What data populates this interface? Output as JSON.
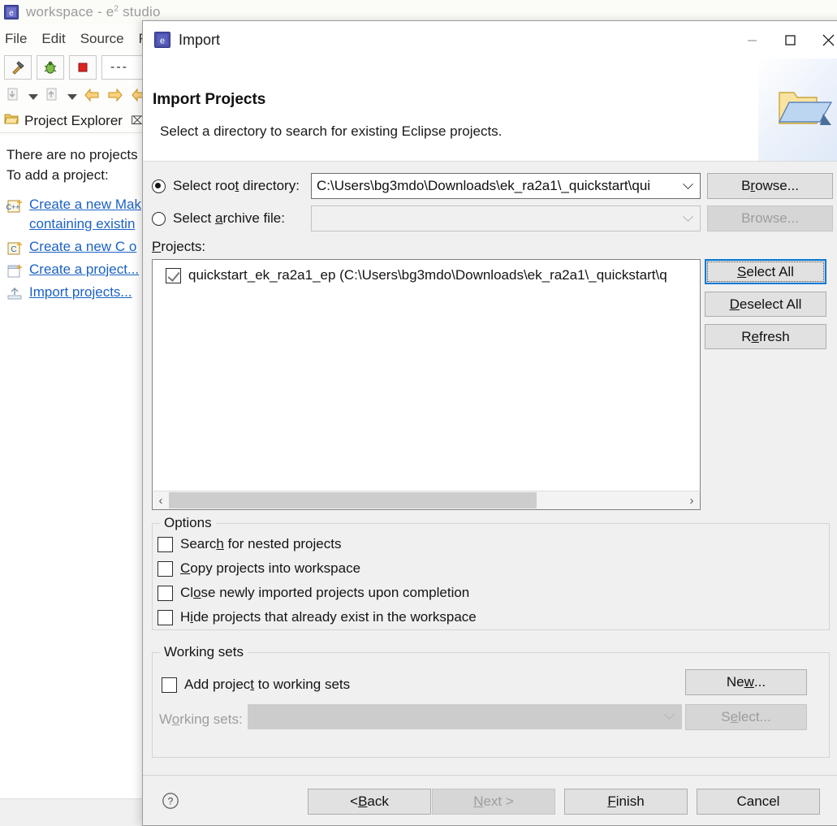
{
  "eclipse": {
    "window_title": "workspace - e2 studio",
    "window_title_main": "workspace - e",
    "window_title_sup": "2",
    "window_title_tail": " studio",
    "menus": [
      "File",
      "Edit",
      "Source",
      "Re"
    ],
    "toolbar": {
      "build_icon": "hammer-icon",
      "debug_icon": "bug-icon",
      "stop_icon": "stop-icon",
      "launch_config_value": "---"
    },
    "view_tab": {
      "label": "Project Explorer",
      "icon": "project-explorer-icon",
      "close_glyph": "⌧"
    },
    "empty_text_line1": "There are no projects",
    "empty_text_line2": "To add a project:",
    "links": [
      {
        "icon": "new-cpp-project-icon",
        "line1": "Create a new Mak",
        "line2": "containing existin"
      },
      {
        "icon": "new-c-project-icon",
        "line1": "Create a new C o",
        "line2": ""
      },
      {
        "icon": "new-project-icon",
        "line1": "Create a project...",
        "line2": ""
      },
      {
        "icon": "import-projects-icon",
        "line1": "Import projects...",
        "line2": ""
      }
    ]
  },
  "dialog": {
    "title": "Import",
    "title_icon": "e2-studio-icon",
    "window_buttons": {
      "minimize": "minimize-icon",
      "maximize": "maximize-icon",
      "close": "close-icon"
    },
    "header": {
      "title": "Import Projects",
      "subtitle": "Select a directory to search for existing Eclipse projects.",
      "banner_icon": "folder-import-icon"
    },
    "source": {
      "root_dir": {
        "label": "Select root directory:",
        "label_pre": "Select roo",
        "label_mnemonic": "t",
        "label_post": " directory:",
        "selected": true,
        "value": "C:\\Users\\bg3mdo\\Downloads\\ek_ra2a1\\_quickstart\\qui",
        "browse_label": "Browse...",
        "browse_pre": "B",
        "browse_mnemonic": "r",
        "browse_post": "owse...",
        "browse_enabled": true
      },
      "archive": {
        "label": "Select archive file:",
        "label_pre": "Select ",
        "label_mnemonic": "a",
        "label_post": "rchive file:",
        "selected": false,
        "value": "",
        "browse_label": "Browse...",
        "browse_enabled": false
      }
    },
    "projects": {
      "label": "Projects:",
      "label_mnemonic": "P",
      "label_post": "rojects:",
      "items": [
        {
          "checked": true,
          "text": "quickstart_ek_ra2a1_ep (C:\\Users\\bg3mdo\\Downloads\\ek_ra2a1\\_quickstart\\q"
        }
      ],
      "scrollbar": {
        "left_arrow": "‹",
        "right_arrow": "›",
        "thumb_position_pct": 0,
        "thumb_width_pct": 69
      },
      "buttons": [
        {
          "name": "select-all",
          "label": "Select All",
          "pre": "",
          "mnemonic": "S",
          "post": "elect All",
          "focused": true,
          "enabled": true
        },
        {
          "name": "deselect-all",
          "label": "Deselect All",
          "pre": "",
          "mnemonic": "D",
          "post": "eselect All",
          "focused": false,
          "enabled": true
        },
        {
          "name": "refresh",
          "label": "Refresh",
          "pre": "R",
          "mnemonic": "e",
          "post": "fresh",
          "focused": false,
          "enabled": true
        }
      ]
    },
    "options": {
      "legend": "Options",
      "items": [
        {
          "checked": false,
          "pre": "Searc",
          "mnemonic": "h",
          "post": " for nested projects",
          "label": "Search for nested projects"
        },
        {
          "checked": false,
          "pre": "",
          "mnemonic": "C",
          "post": "opy projects into workspace",
          "label": "Copy projects into workspace"
        },
        {
          "checked": false,
          "pre": "Cl",
          "mnemonic": "o",
          "post": "se newly imported projects upon completion",
          "label": "Close newly imported projects upon completion"
        },
        {
          "checked": false,
          "pre": "H",
          "mnemonic": "i",
          "post": "de projects that already exist in the workspace",
          "label": "Hide projects that already exist in the workspace"
        }
      ]
    },
    "working_sets": {
      "legend": "Working sets",
      "add_checkbox": {
        "checked": false,
        "pre": "Add projec",
        "mnemonic": "t",
        "post": " to working sets",
        "label": "Add project to working sets"
      },
      "new_button": {
        "label": "New...",
        "pre": "Ne",
        "mnemonic": "w",
        "post": "...",
        "enabled": true
      },
      "combo_label": "Working sets:",
      "combo_label_pre": "W",
      "combo_label_mnemonic": "o",
      "combo_label_post": "rking sets:",
      "combo_value": "",
      "combo_enabled": false,
      "select_button": {
        "label": "Select...",
        "pre": "S",
        "mnemonic": "e",
        "post": "lect...",
        "enabled": false
      }
    },
    "footer": {
      "help_icon": "help-icon",
      "buttons": [
        {
          "name": "back",
          "label": "< Back",
          "pre": "< ",
          "mnemonic": "B",
          "post": "ack",
          "enabled": true
        },
        {
          "name": "next",
          "label": "Next >",
          "pre": "",
          "mnemonic": "N",
          "post": "ext >",
          "enabled": false
        },
        {
          "name": "finish",
          "label": "Finish",
          "pre": "",
          "mnemonic": "F",
          "post": "inish",
          "enabled": true
        },
        {
          "name": "cancel",
          "label": "Cancel",
          "pre": "Cancel",
          "mnemonic": "",
          "post": "",
          "enabled": true
        }
      ]
    }
  },
  "colors": {
    "dialog_bg": "#f0f0f0",
    "dialog_header_bg": "#ffffff",
    "accent_focus": "#0078d7",
    "link": "#1b62c4",
    "button_face": "#e1e1e1"
  }
}
